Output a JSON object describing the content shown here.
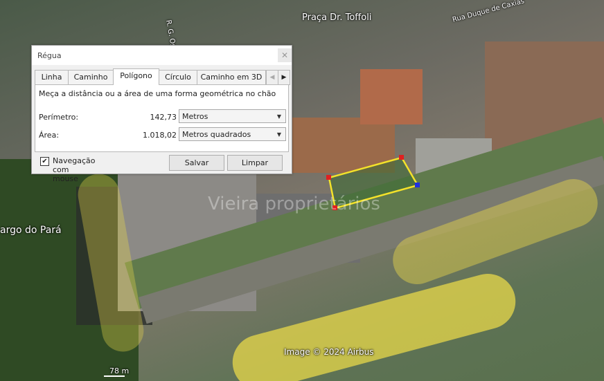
{
  "map": {
    "place_labels": [
      "Praça Dr. Toffoli",
      "Rua Duque de Caxias",
      "argo do Pará",
      "R. G. Osó"
    ],
    "watermark": "Vieira proprietários",
    "attribution": "Image © 2024 Airbus",
    "scale": "78 m",
    "colors": {
      "polygon_edge": "#f4e22a",
      "polygon_vertex": "#e02020",
      "highlight": "#e8d84a"
    }
  },
  "dialog": {
    "title": "Régua",
    "close_icon": "close-icon",
    "tabs": [
      "Linha",
      "Caminho",
      "Polígono",
      "Círculo",
      "Caminho em 3D"
    ],
    "active_tab": "Polígono",
    "description": "Meça a distância ou a área de uma forma geométrica no chão",
    "perimeter": {
      "label": "Perímetro:",
      "value": "142,73",
      "unit": "Metros"
    },
    "area": {
      "label": "Área:",
      "value": "1.018,02",
      "unit": "Metros quadrados"
    },
    "mouse_nav": {
      "label": "Navegação com mouse",
      "checked": true
    },
    "save_label": "Salvar",
    "clear_label": "Limpar"
  }
}
